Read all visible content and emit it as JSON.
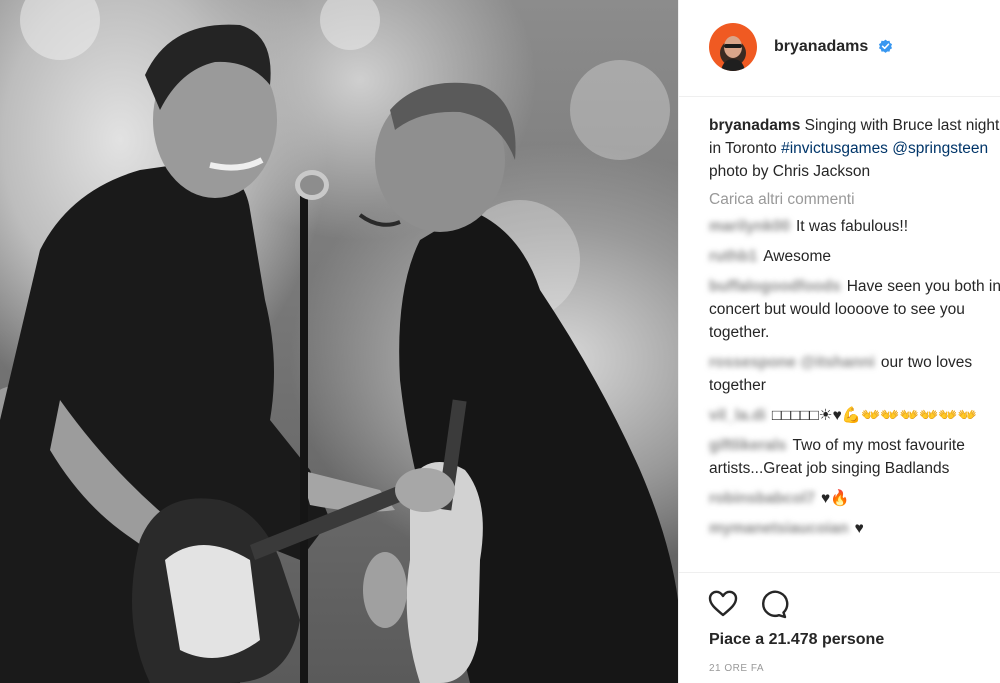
{
  "post": {
    "username": "bryanadams",
    "caption_text": "Singing with Bruce last night",
    "caption_line2_text": "in Toronto",
    "hashtag": "#invictusgames",
    "mention": "@springsteen",
    "caption_line3_text": "photo by Chris Jackson",
    "load_more": "Carica altri commenti",
    "likes": "Piace a 21.478 persone",
    "time": "21 ORE FA"
  },
  "comments": [
    {
      "user": "marilynk00",
      "text": "It was fabulous!!"
    },
    {
      "user": "ruthb1",
      "text": "Awesome"
    },
    {
      "user": "buffalogoodfoods",
      "text": "Have seen you both in"
    },
    {
      "user": "",
      "text": "concert but would loooove to see you"
    },
    {
      "user": "",
      "text": "together."
    },
    {
      "user": "rossespone @itshanni",
      "text": "our two loves"
    },
    {
      "user": "",
      "text": "together"
    },
    {
      "user": "vil_la.di",
      "text": "□□□□□☀♥💪👐👐👐👐👐👐"
    },
    {
      "user": "giftlikerals",
      "text": "Two of my most favourite"
    },
    {
      "user": "",
      "text": "artists...Great job singing Badlands"
    },
    {
      "user": "robinsbabcol7",
      "text": "♥🔥"
    },
    {
      "user": "mymanetsiaucoian",
      "text": "♥"
    }
  ],
  "icons": {
    "like": "heart-icon",
    "comment": "comment-bubble-icon",
    "verified": "verified-badge-icon"
  },
  "colors": {
    "avatar_bg": "#f05a22",
    "verified": "#3897f0",
    "hashtag": "#003569",
    "muted": "#999999"
  }
}
